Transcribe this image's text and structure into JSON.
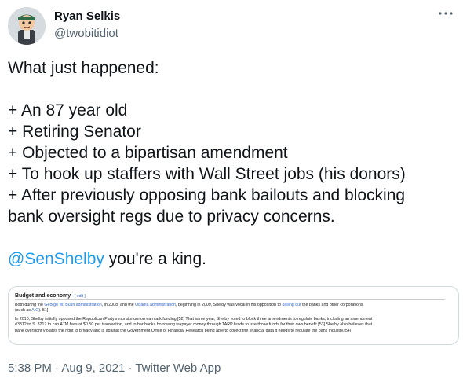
{
  "author": {
    "display_name": "Ryan Selkis",
    "handle": "@twobitidiot"
  },
  "tweet": {
    "lines": [
      "What just happened:",
      "",
      "+ An 87 year old",
      "+ Retiring Senator",
      "+ Objected to a bipartisan amendment",
      "+ To hook up staffers with Wall Street jobs (his donors)",
      "+ After previously opposing bank bailouts and blocking",
      "bank oversight regs due to privacy concerns.",
      ""
    ],
    "mention": "@SenShelby",
    "mention_suffix": " you're a king."
  },
  "embed": {
    "heading": "Budget and economy",
    "edit_label": "[ edit ]",
    "para1": {
      "l1a": "Both during the ",
      "l1b": "George W. Bush administration",
      "l1c": ", in 2008, and the ",
      "l1d": "Obama administration",
      "l1e": ", beginning in 2009, Shelby was vocal in his opposition to ",
      "l1f": "bailing out",
      "l1g": " the banks and other corporations",
      "l2a": "(such as ",
      "l2b": "AIG",
      "l2c": ").[51]"
    },
    "para2": {
      "l1": "In 2010, Shelby initially opposed the Republican Party's moratorium on earmark funding.[52] That same year, Shelby voted to block three amendments to regulate banks, including an amendment",
      "l2": "#3812 to S. 3217 to cap ATM fees at $0.50 per transaction, and to bar banks borrowing taxpayer money through TARP funds to use those funds for their own benefit.[53] Shelby also believes that",
      "l3": "bank oversight violates the right to privacy and is against the Government Office of Financial Research being able to collect the financial data it needs to regulate the bank industry.[54]"
    }
  },
  "meta": {
    "time": "5:38 PM",
    "separator1": " · ",
    "date": "Aug 9, 2021",
    "separator2": " · ",
    "source": "Twitter Web App"
  },
  "icons": {
    "more": "more-horizontal-icon"
  },
  "colors": {
    "link": "#1d9bf0",
    "secondary_text": "#536471",
    "wiki_link": "#3366cc"
  }
}
